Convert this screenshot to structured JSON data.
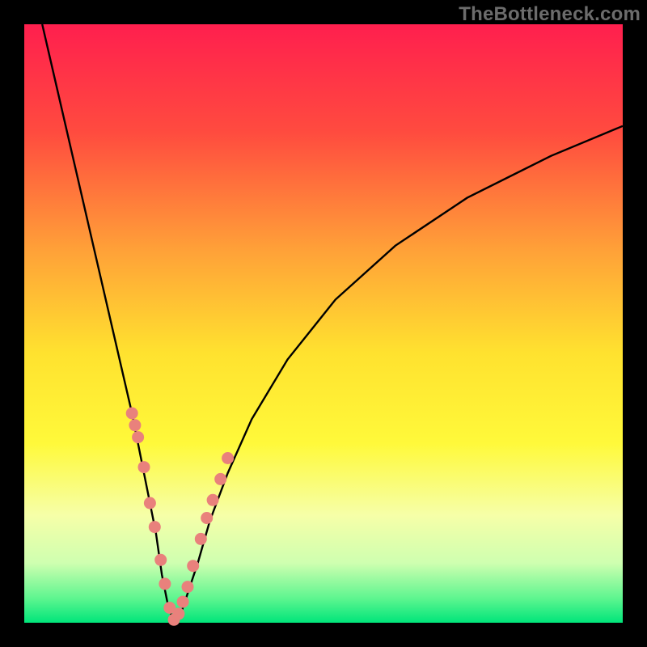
{
  "watermark": "TheBottleneck.com",
  "colors": {
    "frame": "#000000",
    "curve_stroke": "#000000",
    "dot_fill": "#e9817c",
    "gradient_stops": [
      {
        "pct": 0,
        "color": "#ff1f4e"
      },
      {
        "pct": 18,
        "color": "#ff4b3f"
      },
      {
        "pct": 38,
        "color": "#ffa238"
      },
      {
        "pct": 55,
        "color": "#ffe22f"
      },
      {
        "pct": 70,
        "color": "#fff93a"
      },
      {
        "pct": 82,
        "color": "#f6ffa8"
      },
      {
        "pct": 90,
        "color": "#cfffb0"
      },
      {
        "pct": 96,
        "color": "#5cf58f"
      },
      {
        "pct": 100,
        "color": "#00e57a"
      }
    ]
  },
  "chart_data": {
    "type": "line",
    "title": "",
    "xlabel": "",
    "ylabel": "",
    "xlim": [
      0,
      100
    ],
    "ylim": [
      0,
      100
    ],
    "note": "Values are approximate, read from pixel positions. y = bottleneck %. Curve reaches 0 near x≈25.",
    "series": [
      {
        "name": "bottleneck-curve",
        "x": [
          3,
          6,
          9,
          12,
          15,
          18,
          20,
          22,
          23,
          24,
          25,
          26,
          27,
          29,
          31,
          34,
          38,
          44,
          52,
          62,
          74,
          88,
          100
        ],
        "y": [
          100,
          87,
          74,
          61,
          48,
          35,
          25,
          15,
          8,
          3,
          0,
          1,
          4,
          10,
          17,
          25,
          34,
          44,
          54,
          63,
          71,
          78,
          83
        ]
      }
    ],
    "highlighted_points": {
      "name": "dots",
      "x": [
        18.0,
        18.5,
        19.0,
        20.0,
        21.0,
        21.8,
        22.8,
        23.5,
        24.3,
        25.0,
        25.8,
        26.5,
        27.3,
        28.2,
        29.5,
        30.5,
        31.5,
        32.8,
        34.0
      ],
      "y": [
        35.0,
        33.0,
        31.0,
        26.0,
        20.0,
        16.0,
        10.5,
        6.5,
        2.5,
        0.5,
        1.5,
        3.5,
        6.0,
        9.5,
        14.0,
        17.5,
        20.5,
        24.0,
        27.5
      ]
    }
  }
}
